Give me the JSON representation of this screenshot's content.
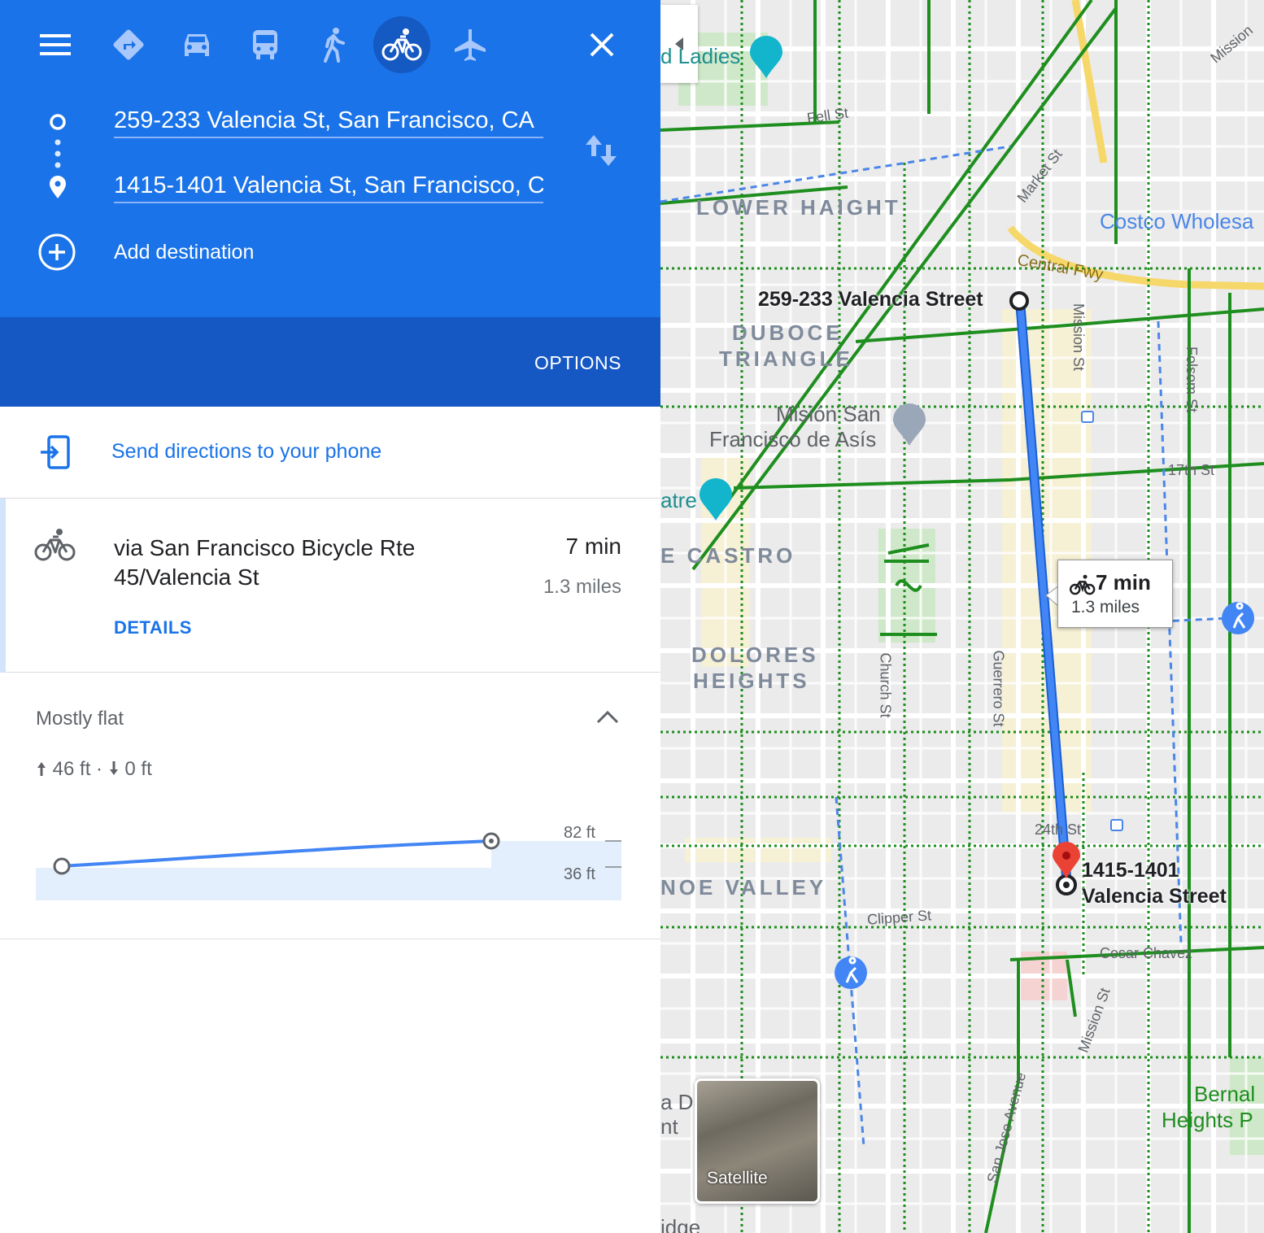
{
  "travel_modes": {
    "menu": "menu-icon",
    "best": "directions-icon",
    "driving": "car-icon",
    "transit": "transit-icon",
    "walking": "walking-icon",
    "cycling": "bicycle-icon",
    "flights": "plane-icon",
    "selected": "cycling",
    "close": "close-icon"
  },
  "origin": {
    "value": "259-233 Valencia St, San Francisco, CA"
  },
  "destination": {
    "value": "1415-1401 Valencia St, San Francisco, C"
  },
  "add_destination": "Add destination",
  "options_label": "OPTIONS",
  "send_directions": "Send directions to your phone",
  "route": {
    "name": "via San Francisco Bicycle Rte 45/Valencia St",
    "time": "7 min",
    "distance": "1.3 miles",
    "details_link": "DETAILS"
  },
  "elevation": {
    "title": "Mostly flat",
    "ascent": "46 ft",
    "descent": "0 ft",
    "separator": "·",
    "max_label": "82 ft",
    "min_label": "36 ft",
    "profile_ft": [
      36,
      82
    ]
  },
  "map": {
    "neighborhoods": [
      "LOWER HAIGHT",
      "DUBOCE",
      "TRIANGLE",
      "E CASTRO",
      "DOLORES",
      "HEIGHTS",
      "NOE VALLEY"
    ],
    "pois": {
      "ladies": "d Ladies",
      "mision_1": "Misión San",
      "mision_2": "Francisco de Asís",
      "theatre": "atre",
      "costco": "Costco Wholesa",
      "bernal_1": "Bernal",
      "bernal_2": "Heights P",
      "partial_1": "a D",
      "partial_2": "nt",
      "partial_3": "idge"
    },
    "streets": {
      "fell": "Fell St",
      "market": "Market St",
      "central_fwy": "Central Fwy",
      "mission_top": "Mission",
      "mission": "Mission St",
      "folsom": "Folsom St",
      "seventeenth": "17th St",
      "church": "Church St",
      "guerrero": "Guerrero St",
      "twentyfourth": "24th St",
      "clipper": "Clipper St",
      "cesar_chavez": "Cesar Chavez",
      "mission_lower": "Mission St",
      "san_jose": "San Jose Avenue"
    },
    "start_label": "259-233 Valencia Street",
    "end_label_1": "1415-1401",
    "end_label_2": "Valencia Street",
    "callout_time": "7 min",
    "callout_distance": "1.3 miles",
    "satellite_label": "Satellite",
    "colors": {
      "route": "#4285f4",
      "bike_lane": "#1e8e1e",
      "map_bg": "#ebebeb",
      "header": "#1a73e8",
      "marker": "#ea4335"
    }
  }
}
